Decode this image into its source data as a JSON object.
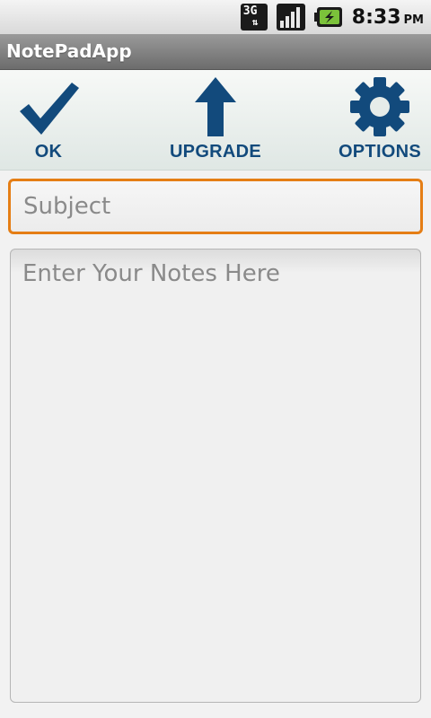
{
  "status_bar": {
    "network_label": "3G",
    "time": "8:33",
    "ampm": "PM",
    "icons": [
      "network-3g-icon",
      "signal-strength-icon",
      "battery-charging-icon"
    ]
  },
  "app": {
    "title": "NotePadApp"
  },
  "toolbar": {
    "ok_label": "OK",
    "upgrade_label": "UPGRADE",
    "options_label": "OPTIONS",
    "icons": [
      "checkmark-icon",
      "up-arrow-icon",
      "gear-icon"
    ],
    "icon_color": "#124a7c"
  },
  "form": {
    "subject_placeholder": "Subject",
    "notes_placeholder": "Enter Your Notes Here",
    "focus_color": "#e57e15"
  }
}
